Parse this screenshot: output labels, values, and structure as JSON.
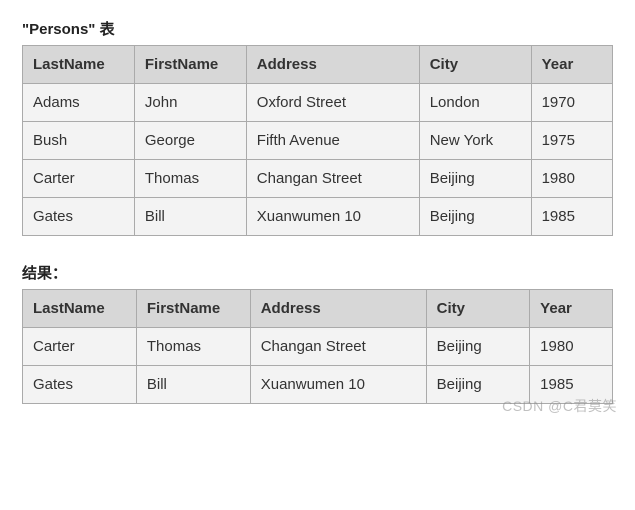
{
  "table1": {
    "title": "\"Persons\" 表",
    "headers": [
      "LastName",
      "FirstName",
      "Address",
      "City",
      "Year"
    ],
    "rows": [
      [
        "Adams",
        "John",
        "Oxford Street",
        "London",
        "1970"
      ],
      [
        "Bush",
        "George",
        "Fifth Avenue",
        "New York",
        "1975"
      ],
      [
        "Carter",
        "Thomas",
        "Changan Street",
        "Beijing",
        "1980"
      ],
      [
        "Gates",
        "Bill",
        "Xuanwumen 10",
        "Beijing",
        "1985"
      ]
    ]
  },
  "table2": {
    "title": "结果：",
    "headers": [
      "LastName",
      "FirstName",
      "Address",
      "City",
      "Year"
    ],
    "rows": [
      [
        "Carter",
        "Thomas",
        "Changan Street",
        "Beijing",
        "1980"
      ],
      [
        "Gates",
        "Bill",
        "Xuanwumen 10",
        "Beijing",
        "1985"
      ]
    ]
  },
  "watermark": "CSDN @C君莫笑"
}
